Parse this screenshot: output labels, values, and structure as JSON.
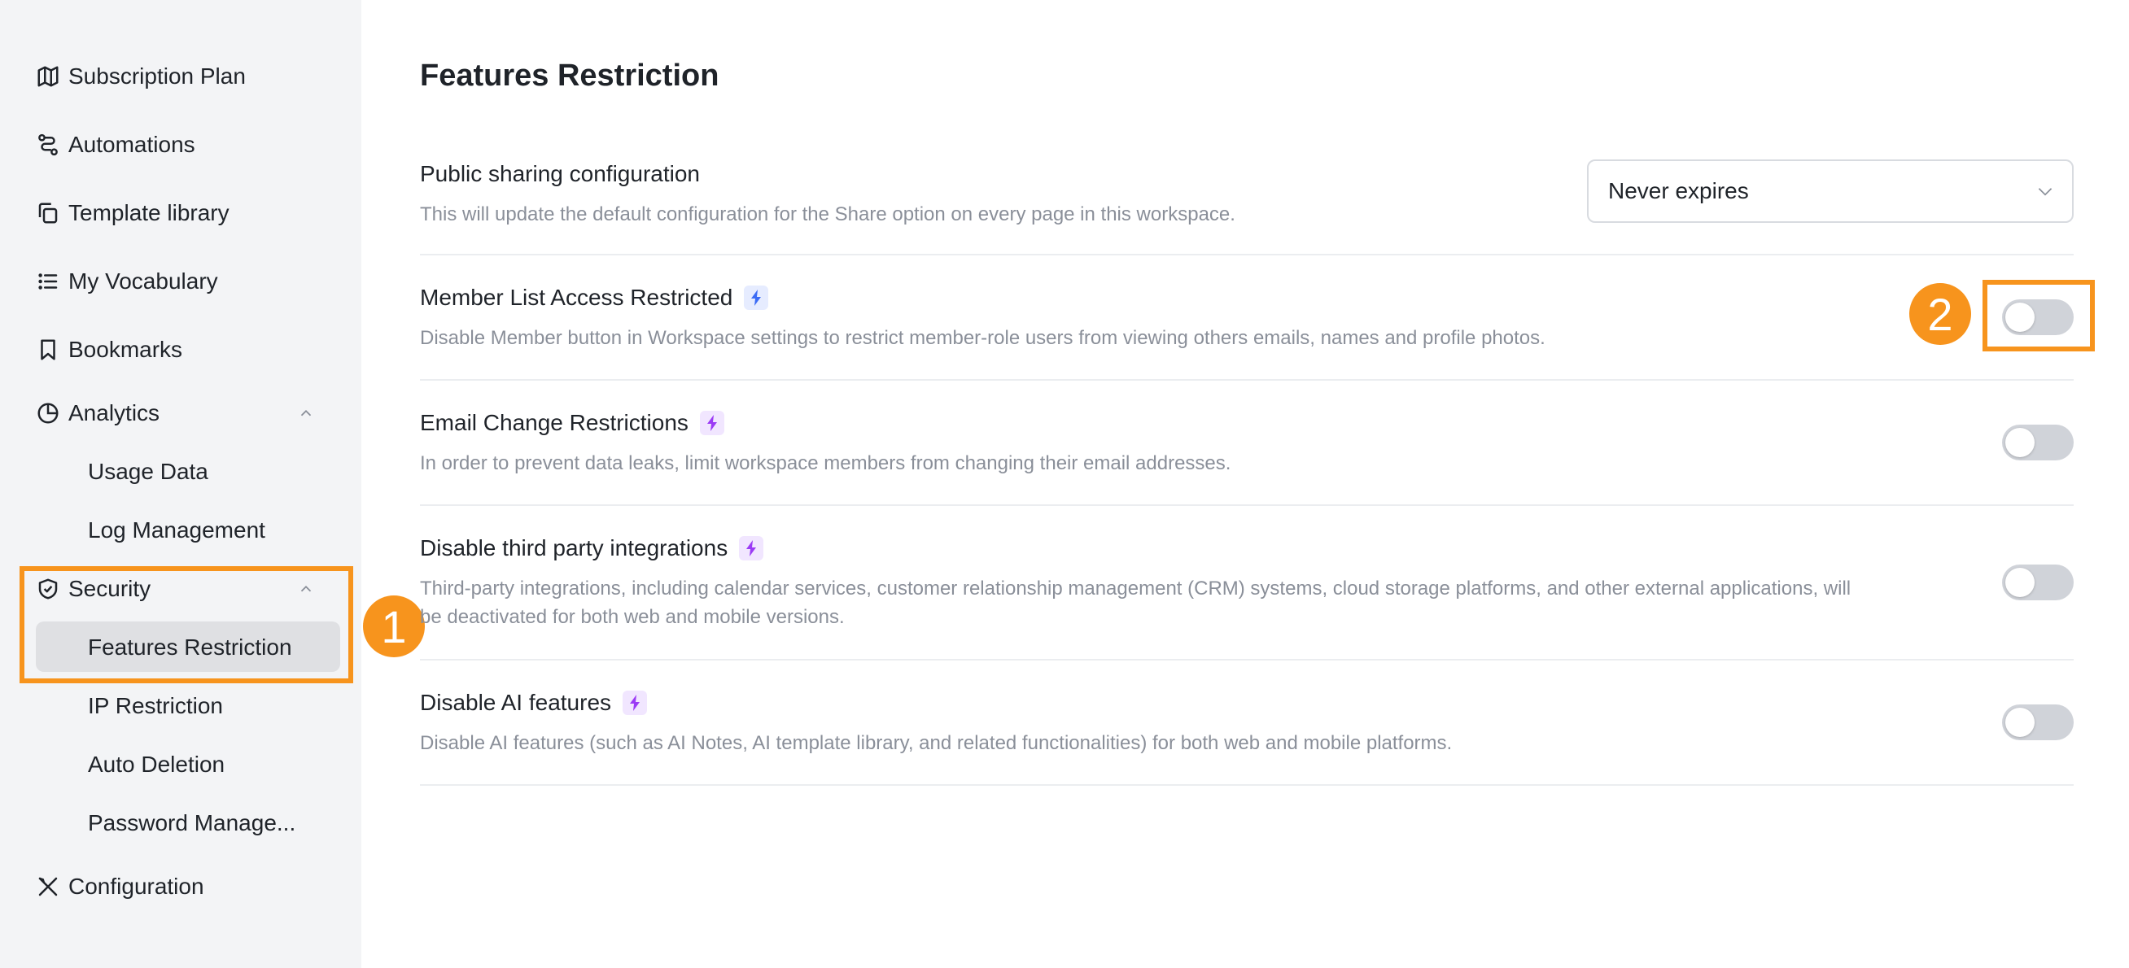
{
  "sidebar": {
    "items": [
      {
        "label": "Subscription Plan",
        "icon": "map-icon"
      },
      {
        "label": "Automations",
        "icon": "automation-icon"
      },
      {
        "label": "Template library",
        "icon": "template-icon"
      },
      {
        "label": "My Vocabulary",
        "icon": "list-icon"
      },
      {
        "label": "Bookmarks",
        "icon": "bookmark-icon"
      },
      {
        "label": "Analytics",
        "icon": "pie-chart-icon"
      },
      {
        "label": "Security",
        "icon": "shield-icon"
      },
      {
        "label": "Configuration",
        "icon": "tools-icon"
      }
    ],
    "analytics_sub": [
      "Usage Data",
      "Log Management"
    ],
    "security_sub": [
      "Features Restriction",
      "IP Restriction",
      "Auto Deletion",
      "Password Manage..."
    ]
  },
  "annotations": {
    "badge1": "1",
    "badge2": "2",
    "color": "#f7941d"
  },
  "main": {
    "title": "Features Restriction",
    "sharing": {
      "title": "Public sharing configuration",
      "desc": "This will update the default configuration for the Share option on every page in this workspace.",
      "select_value": "Never expires"
    },
    "settings": [
      {
        "title": "Member List Access Restricted",
        "desc": "Disable Member button in Workspace settings to restrict member-role users from viewing others emails, names and profile photos.",
        "enabled": false
      },
      {
        "title": "Email Change Restrictions",
        "desc": "In order to prevent data leaks, limit workspace members from changing their email addresses.",
        "enabled": false
      },
      {
        "title": "Disable third party integrations",
        "desc1": "Third-party integrations, including calendar services, customer relationship management (CRM) systems, cloud storage platforms, and other external applications, will",
        "desc2": "be deactivated for both web and mobile versions.",
        "enabled": false
      },
      {
        "title": "Disable AI features",
        "desc": "Disable AI features (such as AI Notes, AI template library, and related functionalities) for both web and mobile platforms.",
        "enabled": false
      }
    ]
  }
}
